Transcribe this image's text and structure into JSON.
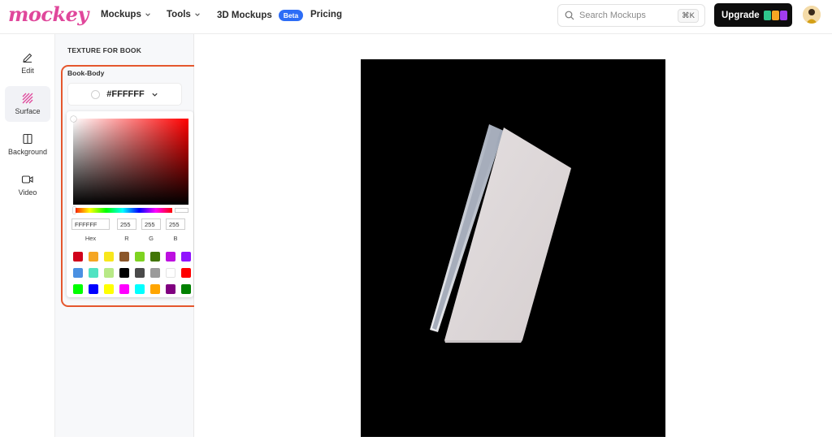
{
  "brand": {
    "logo": "mockey"
  },
  "nav": {
    "mockups": "Mockups",
    "tools": "Tools",
    "mockups3d": "3D Mockups",
    "beta": "Beta",
    "pricing": "Pricing"
  },
  "search": {
    "placeholder": "Search Mockups",
    "shortcut": "⌘K"
  },
  "upgrade": {
    "label": "Upgrade"
  },
  "rail": {
    "edit": "Edit",
    "surface": "Surface",
    "background": "Background",
    "video": "Video"
  },
  "panel": {
    "title": "TEXTURE FOR BOOK",
    "section": "Book-Body",
    "selected_color": "#FFFFFF"
  },
  "picker": {
    "hex": "FFFFFF",
    "r": "255",
    "g": "255",
    "b": "255",
    "hex_label": "Hex",
    "r_label": "R",
    "g_label": "G",
    "b_label": "B",
    "presets": [
      "#d0021b",
      "#f5a623",
      "#f8e71c",
      "#8b572a",
      "#7ed321",
      "#417505",
      "#bd10e0",
      "#9013fe",
      "#4a90e2",
      "#50e3c2",
      "#b8e986",
      "#000000",
      "#4a4a4a",
      "#9b9b9b",
      "#ffffff",
      "#ff0000",
      "#00ff00",
      "#0000ff",
      "#ffff00",
      "#ff00ff",
      "#00ffff",
      "#ffa500",
      "#800080",
      "#008000"
    ]
  },
  "colors": {
    "accent": "#2d6df6",
    "highlight": "#e5572d",
    "brand": "#e0479b"
  }
}
